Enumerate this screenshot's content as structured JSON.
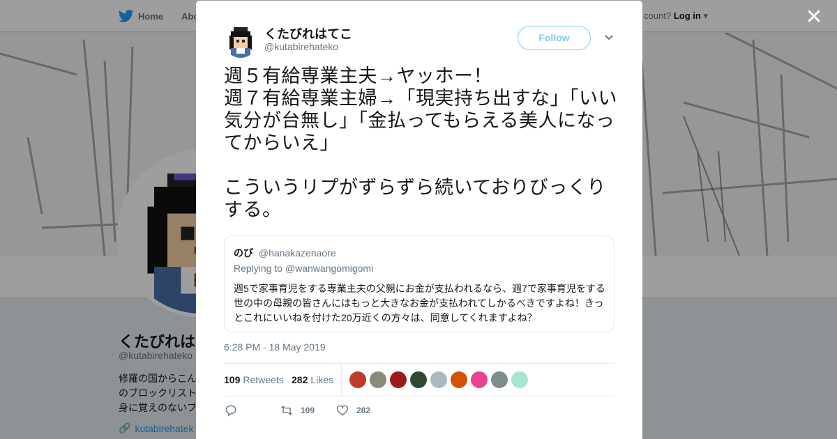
{
  "background": {
    "nav": {
      "home_label": "Home",
      "about_label": "Abo",
      "account_text": "count?",
      "login_label": "Log in"
    },
    "profile": {
      "name": "くたびれはて",
      "handle": "@kutabirehateko",
      "bio_lines": [
        "修羅の国からこん",
        "のブロックリスト",
        "身に覚えのないブ"
      ],
      "link": "kutabirehatek"
    }
  },
  "modal": {
    "close_icon": "close-icon",
    "author": {
      "name": "くたびれはてこ",
      "handle": "@kutabirehateko"
    },
    "follow_label": "Follow",
    "tweet_text": "週５有給専業主夫→ヤッホー！\n週７有給専業主婦→「現実持ち出すな」「いい気分が台無し」「金払ってもらえる美人になってからいえ」\n\nこういうリプがずらずら続いておりびっくりする。",
    "quote": {
      "name": "のび",
      "handle": "@hanakazenaore",
      "replying": "Replying to @wanwangomigomi",
      "text": "週5で家事育児をする専業主夫の父親にお金が支払われるなら、週7で家事育児をする世の中の母親の皆さんにはもっと大きなお金が支払われてしかるべきですよね！きっとこれにいいねを付けた20万近くの方々は、同意してくれますよね？"
    },
    "timestamp": "6:28 PM - 18 May 2019",
    "stats": {
      "retweets_count": "109",
      "retweets_label": "Retweets",
      "likes_count": "282",
      "likes_label": "Likes"
    },
    "likers_colors": [
      "#c0392b",
      "#8a8a7a",
      "#9b1b1b",
      "#2e4a2e",
      "#aab8c2",
      "#d35400",
      "#e84393",
      "#7f8c8d",
      "#a8e6cf"
    ],
    "actions": {
      "reply_count": "",
      "retweet_count": "109",
      "like_count": "282"
    }
  }
}
